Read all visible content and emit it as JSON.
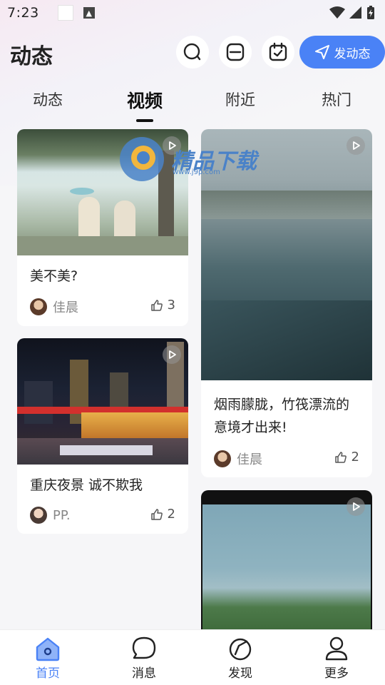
{
  "status_bar": {
    "time": "7:23"
  },
  "header": {
    "title": "动态",
    "post_button_label": "发动态"
  },
  "tabs": [
    {
      "label": "动态",
      "active": false
    },
    {
      "label": "视频",
      "active": true
    },
    {
      "label": "附近",
      "active": false
    },
    {
      "label": "热门",
      "active": false
    }
  ],
  "watermark": {
    "text": "精品下载",
    "sub": "www.j9p.com"
  },
  "feed": [
    {
      "title": "美不美?",
      "author": "佳晨",
      "likes": "3"
    },
    {
      "title": "重庆夜景 诚不欺我",
      "author": "PP.",
      "likes": "2"
    },
    {
      "title_line1": "烟雨朦胧，竹筏漂流的",
      "title_line2": "意境才出来!",
      "author": "佳晨",
      "likes": "2"
    }
  ],
  "bottom_nav": [
    {
      "label": "首页",
      "icon": "home-icon",
      "active": true
    },
    {
      "label": "消息",
      "icon": "message-icon",
      "active": false
    },
    {
      "label": "发现",
      "icon": "discover-icon",
      "active": false
    },
    {
      "label": "更多",
      "icon": "profile-icon",
      "active": false
    }
  ],
  "colors": {
    "accent": "#4a82f6",
    "background": "#f6f6f8"
  }
}
